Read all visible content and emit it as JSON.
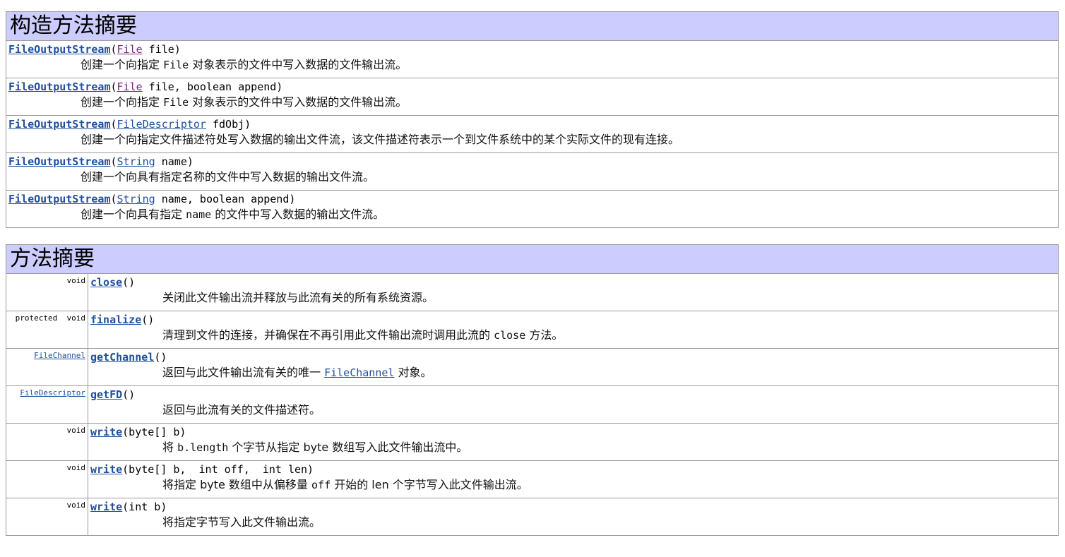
{
  "constructor_summary": {
    "title": "构造方法摘要",
    "rows": [
      {
        "name": "FileOutputStream",
        "open": "(",
        "param_type": "File",
        "param_rest": " file)",
        "desc_pre": "创建一个向指定 ",
        "desc_code": "File",
        "desc_post": " 对象表示的文件中写入数据的文件输出流。"
      },
      {
        "name": "FileOutputStream",
        "open": "(",
        "param_type": "File",
        "param_rest": " file, boolean append)",
        "desc_pre": "创建一个向指定 ",
        "desc_code": "File",
        "desc_post": " 对象表示的文件中写入数据的文件输出流。"
      },
      {
        "name": "FileOutputStream",
        "open": "(",
        "param_type": "FileDescriptor",
        "param_rest": " fdObj)",
        "desc_pre": "创建一个向指定文件描述符处写入数据的输出文件流，该文件描述符表示一个到文件系统中的某个实际文件的现有连接。",
        "desc_code": "",
        "desc_post": ""
      },
      {
        "name": "FileOutputStream",
        "open": "(",
        "param_type": "String",
        "param_rest": " name)",
        "desc_pre": "创建一个向具有指定名称的文件中写入数据的输出文件流。",
        "desc_code": "",
        "desc_post": ""
      },
      {
        "name": "FileOutputStream",
        "open": "(",
        "param_type": "String",
        "param_rest": " name, boolean append)",
        "desc_pre": "创建一个向具有指定 ",
        "desc_code": "name",
        "desc_post": " 的文件中写入数据的输出文件流。"
      }
    ]
  },
  "method_summary": {
    "title": "方法摘要",
    "rows": [
      {
        "modifier": "void",
        "return_link": "",
        "name": "close",
        "params": "()",
        "desc_pre": "关闭此文件输出流并释放与此流有关的所有系统资源。",
        "desc_code": "",
        "desc_link": "",
        "desc_post": ""
      },
      {
        "modifier": "protected  void",
        "return_link": "",
        "name": "finalize",
        "params": "()",
        "desc_pre": "清理到文件的连接，并确保在不再引用此文件输出流时调用此流的 ",
        "desc_code": "close",
        "desc_link": "",
        "desc_post": " 方法。"
      },
      {
        "modifier": "",
        "return_link": "FileChannel",
        "name": "getChannel",
        "params": "()",
        "desc_pre": "返回与此文件输出流有关的唯一 ",
        "desc_code": "",
        "desc_link": "FileChannel",
        "desc_post": " 对象。"
      },
      {
        "modifier": "",
        "return_link": "FileDescriptor",
        "name": "getFD",
        "params": "()",
        "desc_pre": "返回与此流有关的文件描述符。",
        "desc_code": "",
        "desc_link": "",
        "desc_post": ""
      },
      {
        "modifier": "void",
        "return_link": "",
        "name": "write",
        "params": "(byte[] b)",
        "desc_pre": "将 ",
        "desc_code": "b.length",
        "desc_link": "",
        "desc_post": " 个字节从指定 byte 数组写入此文件输出流中。"
      },
      {
        "modifier": "void",
        "return_link": "",
        "name": "write",
        "params": "(byte[] b,  int off,  int len)",
        "desc_pre": "将指定 byte 数组中从偏移量 ",
        "desc_code": "off",
        "desc_link": "",
        "desc_post": " 开始的 len 个字节写入此文件输出流。"
      },
      {
        "modifier": "void",
        "return_link": "",
        "name": "write",
        "params": "(int b)",
        "desc_pre": "将指定字节写入此文件输出流。",
        "desc_code": "",
        "desc_link": "",
        "desc_post": ""
      }
    ]
  }
}
